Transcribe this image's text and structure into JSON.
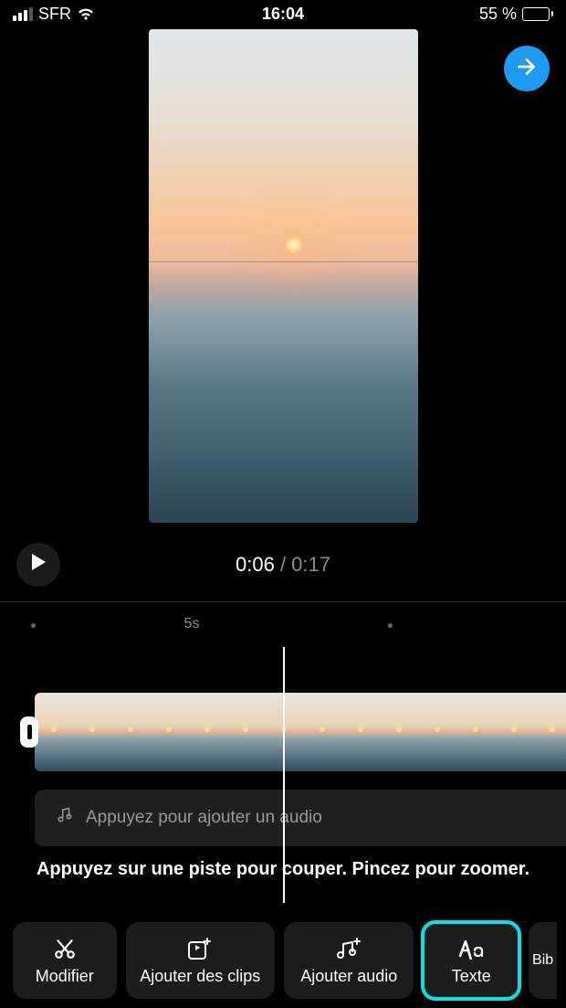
{
  "status_bar": {
    "carrier": "SFR",
    "time": "16:04",
    "battery_percent": "55 %"
  },
  "playback": {
    "current_time": "0:06",
    "separator": " / ",
    "total_time": "0:17"
  },
  "ruler": {
    "mark_label": "5s"
  },
  "audio_track": {
    "placeholder": "Appuyez pour ajouter un audio"
  },
  "hint": {
    "text": "Appuyez sur une piste pour couper. Pincez pour zoomer."
  },
  "toolbar": {
    "modify": "Modifier",
    "add_clips": "Ajouter des clips",
    "add_audio": "Ajouter audio",
    "text": "Texte",
    "library_partial": "Bib"
  },
  "colors": {
    "accent": "#1d9bf0",
    "highlight": "#00e6e6"
  }
}
